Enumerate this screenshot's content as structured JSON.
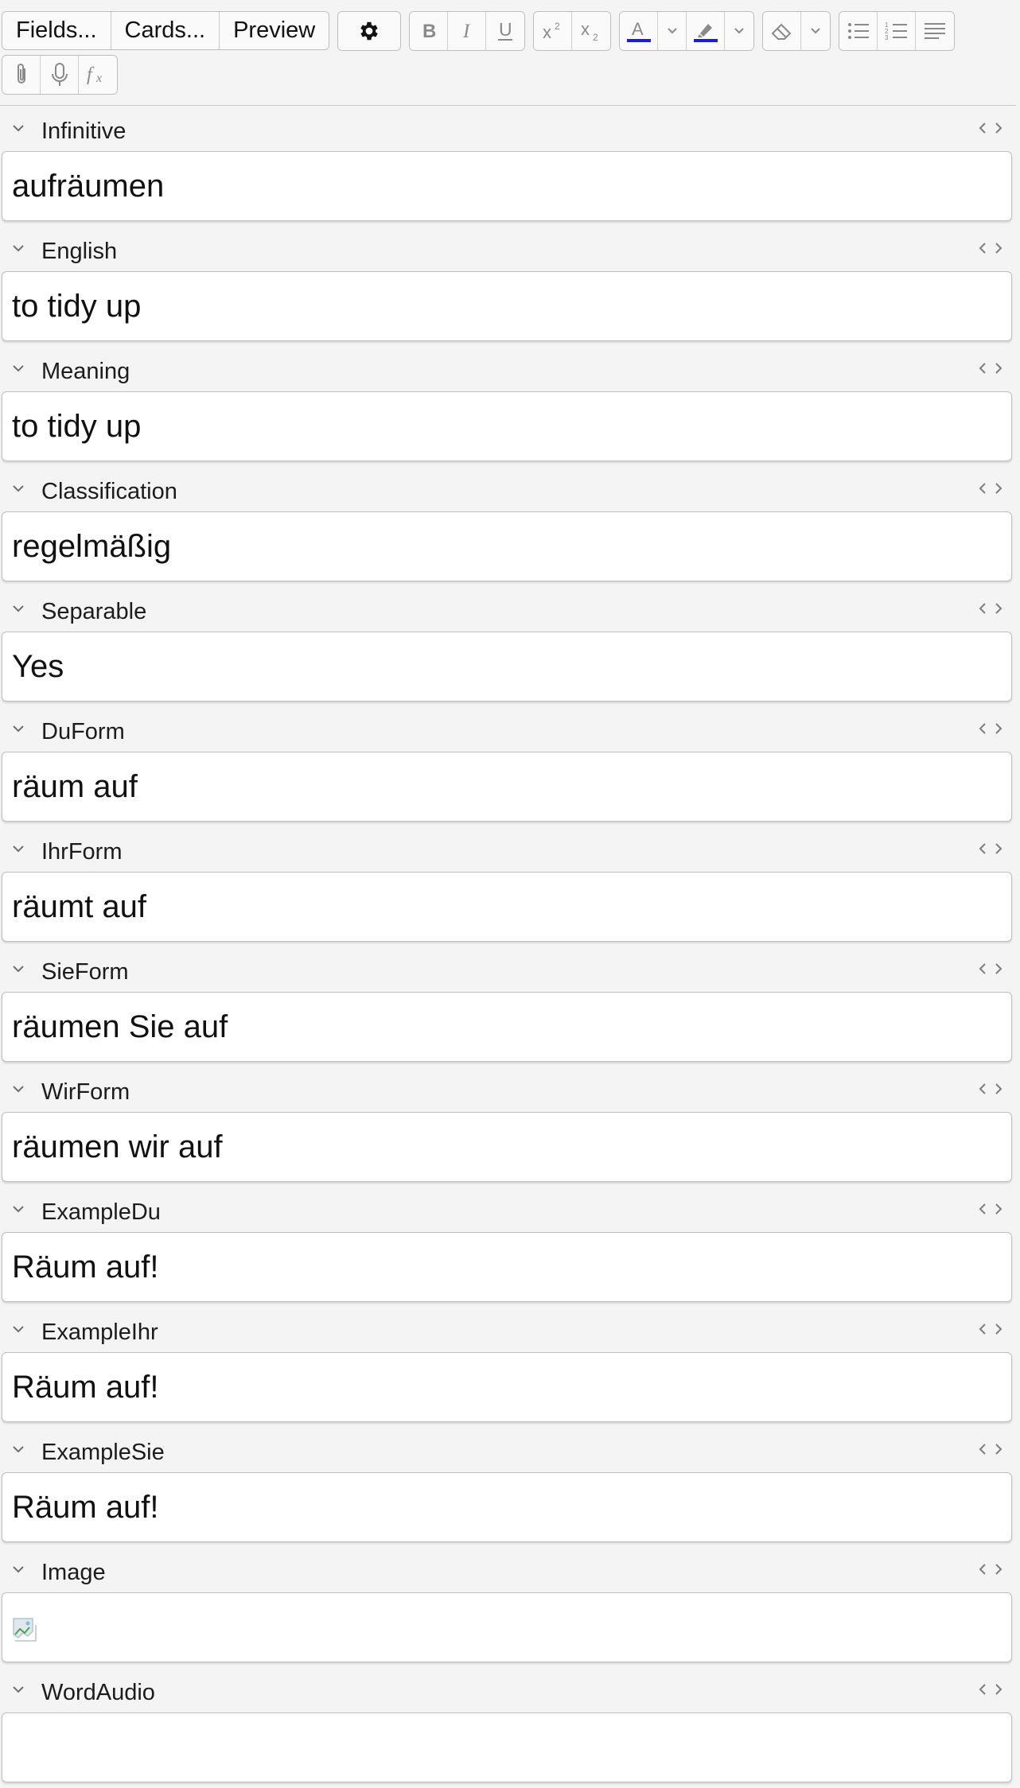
{
  "toolbar": {
    "fields_label": "Fields...",
    "cards_label": "Cards...",
    "preview_label": "Preview",
    "text_color": "#1a1ae6",
    "highlight_color": "#1a1ae6"
  },
  "fields": [
    {
      "label": "Infinitive",
      "value": "aufräumen"
    },
    {
      "label": "English",
      "value": "to tidy up"
    },
    {
      "label": "Meaning",
      "value": "to tidy up"
    },
    {
      "label": "Classification",
      "value": "regelmäßig"
    },
    {
      "label": "Separable",
      "value": "Yes"
    },
    {
      "label": "DuForm",
      "value": "räum auf"
    },
    {
      "label": "IhrForm",
      "value": "räumt auf"
    },
    {
      "label": "SieForm",
      "value": "räumen Sie auf"
    },
    {
      "label": "WirForm",
      "value": "räumen wir auf"
    },
    {
      "label": "ExampleDu",
      "value": "Räum auf!"
    },
    {
      "label": "ExampleIhr",
      "value": "Räum auf!"
    },
    {
      "label": "ExampleSie",
      "value": "Räum auf!"
    },
    {
      "label": "Image",
      "value": ""
    },
    {
      "label": "WordAudio",
      "value": ""
    }
  ]
}
